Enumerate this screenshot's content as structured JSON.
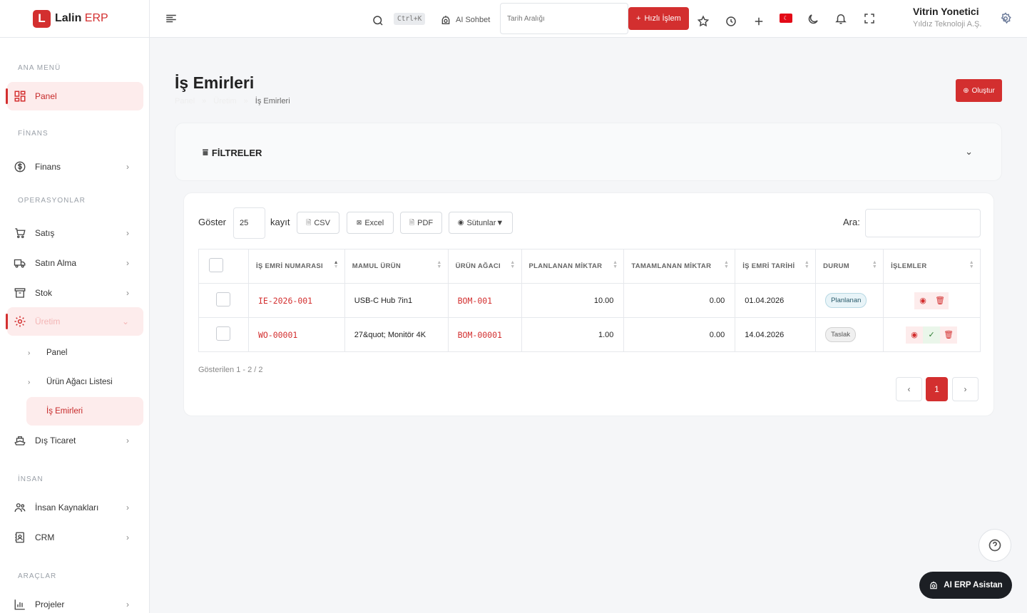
{
  "brand": {
    "logo_letter": "L",
    "name": "Lalin",
    "suffix": "ERP"
  },
  "sidebar": {
    "sections": [
      "ANA MENÜ",
      "FİNANS",
      "OPERASYONLAR",
      "İNSAN",
      "ARAÇLAR"
    ],
    "items": [
      {
        "label": "Panel"
      },
      {
        "label": "Finans"
      },
      {
        "label": "Satış"
      },
      {
        "label": "Satın Alma"
      },
      {
        "label": "Stok"
      },
      {
        "label": "Üretim"
      },
      {
        "label": "Dış Ticaret"
      },
      {
        "label": "İnsan Kaynakları"
      },
      {
        "label": "CRM"
      },
      {
        "label": "Projeler"
      }
    ],
    "sub_items": [
      {
        "label": "Panel"
      },
      {
        "label": "Ürün Ağacı Listesi"
      },
      {
        "label": "İş Emirleri"
      }
    ]
  },
  "topbar": {
    "shortcut": "Ctrl+K",
    "ai_chat": "AI Sohbet",
    "date_placeholder": "Tarih Aralığı",
    "quick_action": "Hızlı İşlem",
    "user_name": "Vitrin Yonetici",
    "user_company": "Yıldız Teknoloji A.Ş."
  },
  "page": {
    "title": "İş Emirleri",
    "breadcrumb": [
      "Panel",
      "Üretim",
      "İş Emirleri"
    ],
    "create_label": "Oluştur"
  },
  "filters": {
    "title": "FİLTRELER"
  },
  "table_controls": {
    "show_label": "Göster",
    "page_size": "25",
    "records_label": "kayıt",
    "csv": "CSV",
    "excel": "Excel",
    "pdf": "PDF",
    "columns": "Sütunlar▼",
    "search_label": "Ara:"
  },
  "table": {
    "headers": [
      "İŞ EMRİ NUMARASI",
      "MAMUL ÜRÜN",
      "ÜRÜN AĞACI",
      "PLANLANAN MİKTAR",
      "TAMAMLANAN MİKTAR",
      "İŞ EMRİ TARİHİ",
      "DURUM",
      "İŞLEMLER"
    ],
    "rows": [
      {
        "number": "IE-2026-001",
        "product": "USB-C Hub 7in1",
        "bom": "BOM-001",
        "planned": "10.00",
        "completed": "0.00",
        "date": "01.04.2026",
        "status": "Planlanan"
      },
      {
        "number": "WO-00001",
        "product": "27&quot; Monitör 4K",
        "bom": "BOM-00001",
        "planned": "1.00",
        "completed": "0.00",
        "date": "14.04.2026",
        "status": "Taslak"
      }
    ]
  },
  "footer": {
    "info": "Gösterilen 1 - 2 / 2",
    "current_page": "1",
    "prev": "‹",
    "next": "›"
  },
  "assistant": {
    "label": "AI ERP Asistan",
    "help": "?"
  },
  "colors": {
    "accent": "#d32f2f",
    "active_bg": "#fdecec"
  }
}
